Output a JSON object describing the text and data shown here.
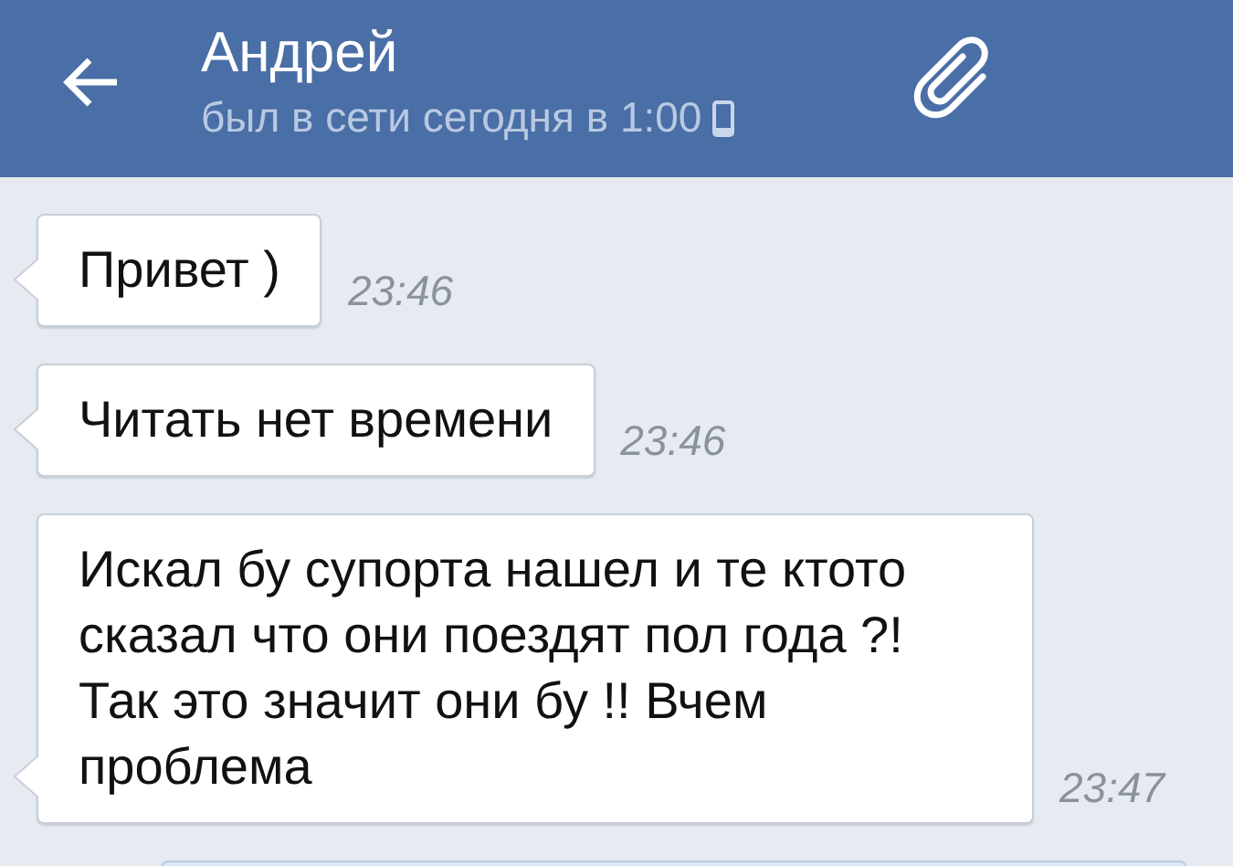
{
  "header": {
    "name": "Андрей",
    "status": "был в сети сегодня в 1:00",
    "mobile": true
  },
  "messages": [
    {
      "kind": "incoming",
      "text": "Привет )",
      "time": "23:46"
    },
    {
      "kind": "incoming",
      "text": "Читать нет времени",
      "time": "23:46"
    },
    {
      "kind": "incoming",
      "text": "Искал бу супорта нашел и те ктото сказал что они поездят пол года ?! Так это значит они бу !! Вчем проблема",
      "time": "23:47"
    },
    {
      "kind": "outgoing"
    }
  ]
}
